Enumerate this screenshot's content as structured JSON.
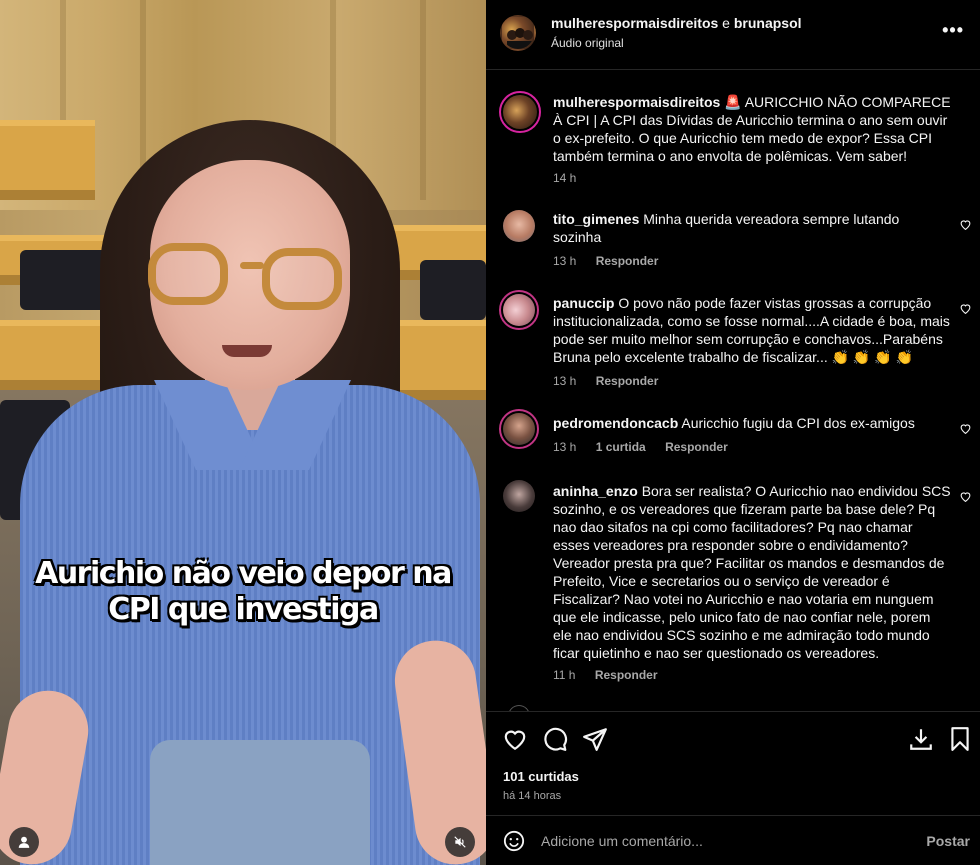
{
  "header": {
    "user1": "mulherespormaisdireitos",
    "and": "e",
    "user2": "brunapsol",
    "subtitle": "Áudio original",
    "more": "•••"
  },
  "video": {
    "caption_line1": "Aurichio não veio depor na",
    "caption_line2": "CPI que investiga"
  },
  "comments": [
    {
      "username": "mulherespormaisdireitos",
      "text": "🚨 AURICCHIO NÃO COMPARECE À CPI | A CPI das Dívidas de Auricchio termina o ano sem ouvir o ex-prefeito. O que Auricchio tem medo de expor? Essa CPI também termina o ano envolta de polêmicas. Vem saber!",
      "time": "14 h"
    },
    {
      "username": "tito_gimenes",
      "text": "Minha querida vereadora sempre lutando sozinha",
      "time": "13 h",
      "reply": "Responder"
    },
    {
      "username": "panuccip",
      "text": "O povo não pode fazer vistas grossas a corrupção institucionalizada, como se fosse normal....A cidade é boa, mais pode ser muito melhor sem corrupção e conchavos...Parabéns Bruna pelo excelente trabalho de fiscalizar... 👏 👏 👏 👏",
      "time": "13 h",
      "reply": "Responder"
    },
    {
      "username": "pedromendoncacb",
      "text": "Auricchio fugiu da CPI dos ex-amigos",
      "time": "13 h",
      "likes": "1 curtida",
      "reply": "Responder"
    },
    {
      "username": "aninha_enzo",
      "text": "Bora ser realista? O Auricchio nao endividou SCS sozinho, e os vereadores que fizeram parte ba base dele? Pq nao dao sitafos na cpi como facilitadores? Pq nao chamar esses vereadores pra responder sobre o endividamento? Vereador presta pra que? Facilitar os mandos e desmandos de Prefeito, Vice e secretarios ou o serviço de vereador é Fiscalizar? Nao votei no Auricchio e nao votaria em nunguem que ele indicasse, pelo unico fato de nao confiar nele, porem ele nao endividou SCS sozinho e me admiração todo mundo ficar quietinho e nao ser questionado os vereadores.",
      "time": "11 h",
      "reply": "Responder"
    }
  ],
  "stats": {
    "likes": "101 curtidas",
    "posted": "há 14 horas"
  },
  "compose": {
    "placeholder": "Adicione um comentário...",
    "post_label": "Postar"
  }
}
